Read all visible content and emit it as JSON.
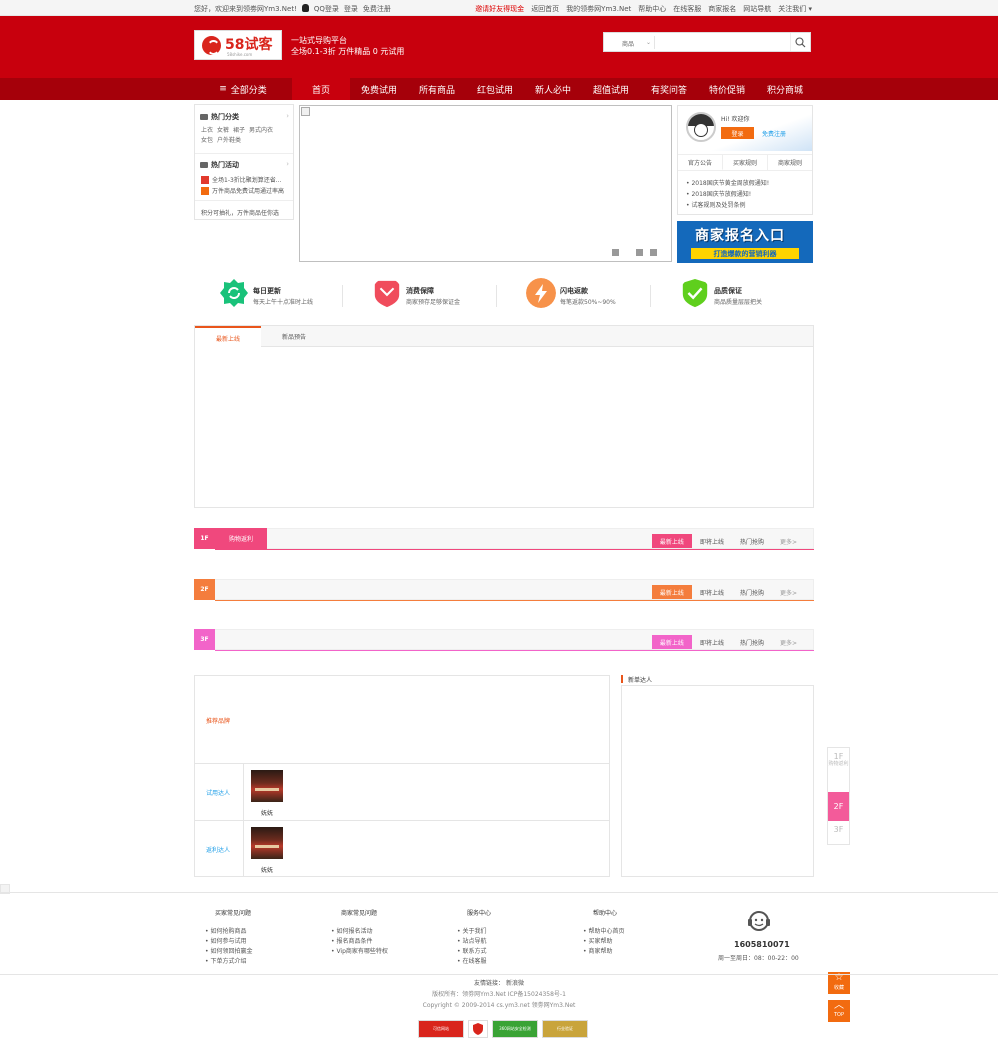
{
  "topbar": {
    "welcome": "您好，欢迎来到领劵网Ym3.Net!",
    "qq_login": "QQ登录",
    "login": "登录",
    "register": "免费注册",
    "links": [
      "邀请好友得现金",
      "返回首页",
      "我的领劵网Ym3.Net",
      "帮助中心",
      "在线客服",
      "商家报名",
      "网站导航",
      "关注我们 ▾"
    ]
  },
  "header": {
    "logo_text": "58试客",
    "logo_sub": "58shike.com",
    "slogan_line1": "一站式导购平台",
    "slogan_line2": "全场0.1-3折 万件精品 0 元试用",
    "search_category": "商品",
    "search_arrow": "⌄",
    "search_placeholder": ""
  },
  "nav": {
    "all_categories": "全部分类",
    "items": [
      "首页",
      "免费试用",
      "所有商品",
      "红包试用",
      "新人必中",
      "超值试用",
      "有奖问答",
      "特价促销",
      "积分商城"
    ]
  },
  "category": {
    "hot_title": "热门分类",
    "hot_links": [
      "上衣",
      "女裤",
      "裙子",
      "男式内衣",
      "女包",
      "户外鞋类"
    ],
    "activity_title": "热门活动",
    "activities": [
      "全场1-3折比聚划算还省...",
      "万件商品免费试用通过率高"
    ],
    "note": "积分可抽礼，万件商品任你选"
  },
  "user": {
    "greeting": "Hi! 欢迎你",
    "login_btn": "登录",
    "register_btn": "免费注册",
    "tabs": [
      "官方公告",
      "买家规则",
      "商家规则"
    ],
    "notices": [
      "2018国庆节黄金周放假通知!",
      "2018国庆节放假通知!",
      "试客规则及处罚条例"
    ]
  },
  "ad": {
    "title": "商家报名入口",
    "subtitle": "打造爆款的营销利器"
  },
  "features": [
    {
      "title": "每日更新",
      "desc": "每天上午十点准时上线",
      "color": "#19c27a"
    },
    {
      "title": "消费保障",
      "desc": "商家预存足够保证金",
      "color": "#f04c5c"
    },
    {
      "title": "闪电返款",
      "desc": "每笔返款50%~90%",
      "color": "#f7924a"
    },
    {
      "title": "品质保证",
      "desc": "商品质量层层把关",
      "color": "#5fcf1d"
    }
  ],
  "tabs": {
    "latest": "最新上线",
    "preview": "新品预告"
  },
  "floors": [
    {
      "num": "1F",
      "name": "购物返利",
      "color": "#f0487d",
      "tabs": [
        "最新上线",
        "即将上线",
        "热门抢购",
        "更多>"
      ]
    },
    {
      "num": "2F",
      "name": "",
      "color": "#f47d3d",
      "tabs": [
        "最新上线",
        "即将上线",
        "热门抢购",
        "更多>"
      ]
    },
    {
      "num": "3F",
      "name": "",
      "color": "#f264c9",
      "tabs": [
        "最新上线",
        "即将上线",
        "热门抢购",
        "更多>"
      ]
    }
  ],
  "recommend": {
    "label": "推荐品牌",
    "rows": [
      {
        "label": "试用达人",
        "name": "妩妩"
      },
      {
        "label": "返利达人",
        "name": "妩妩"
      }
    ]
  },
  "newbie": {
    "title": "新单达人"
  },
  "floor_nav": [
    {
      "num": "1F",
      "sub": "购物返利"
    },
    {
      "num": "2F",
      "sub": ""
    },
    {
      "num": "3F",
      "sub": ""
    }
  ],
  "side": {
    "favorite": "收藏",
    "top": "TOP"
  },
  "footer": {
    "columns": [
      {
        "title": "买家常见问题",
        "items": [
          "如何抢购商品",
          "如何参与试用",
          "如何领回拍赢金",
          "下单方式介绍"
        ]
      },
      {
        "title": "商家常见问题",
        "items": [
          "如何报名活动",
          "报名商品条件",
          "Vip商家有哪些特权"
        ]
      },
      {
        "title": "服务中心",
        "items": [
          "关于我们",
          "站点导航",
          "联系方式",
          "在线客服"
        ]
      },
      {
        "title": "帮助中心",
        "items": [
          "帮助中心首页",
          "买家帮助",
          "商家帮助"
        ]
      }
    ],
    "phone": "1605810071",
    "hours": "周一至周日：08：00-22：00",
    "friend_links_label": "友情链接：",
    "friend_link": "新浪微",
    "copyright1": "版权所有：领劵网Ym3.Net ICP备15024358号-1",
    "copyright2": "Copyright © 2009-2014 cs.ym3.net 领劵网Ym3.Net",
    "badges": [
      "可信网站",
      "卫星徽章",
      "360网站安全检测",
      "行业验证"
    ]
  }
}
